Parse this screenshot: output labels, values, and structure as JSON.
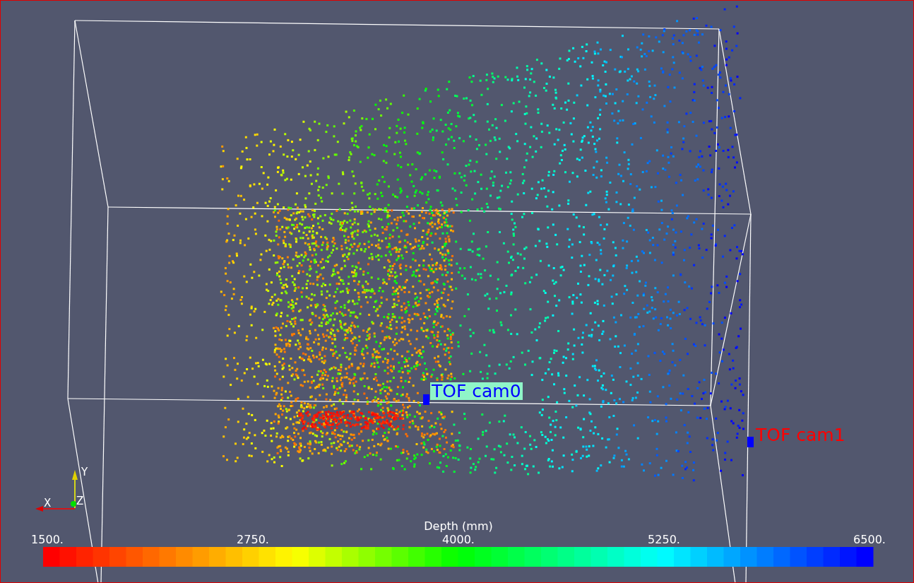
{
  "view": {
    "camera_labels": [
      {
        "text": "TOF cam0"
      },
      {
        "text": "TOF cam1"
      }
    ],
    "axes": [
      "X",
      "Y",
      "Z"
    ],
    "colorbar": {
      "title": "Depth (mm)",
      "ticks": [
        "1500.",
        "2750.",
        "4000.",
        "5250.",
        "6500."
      ]
    }
  }
}
